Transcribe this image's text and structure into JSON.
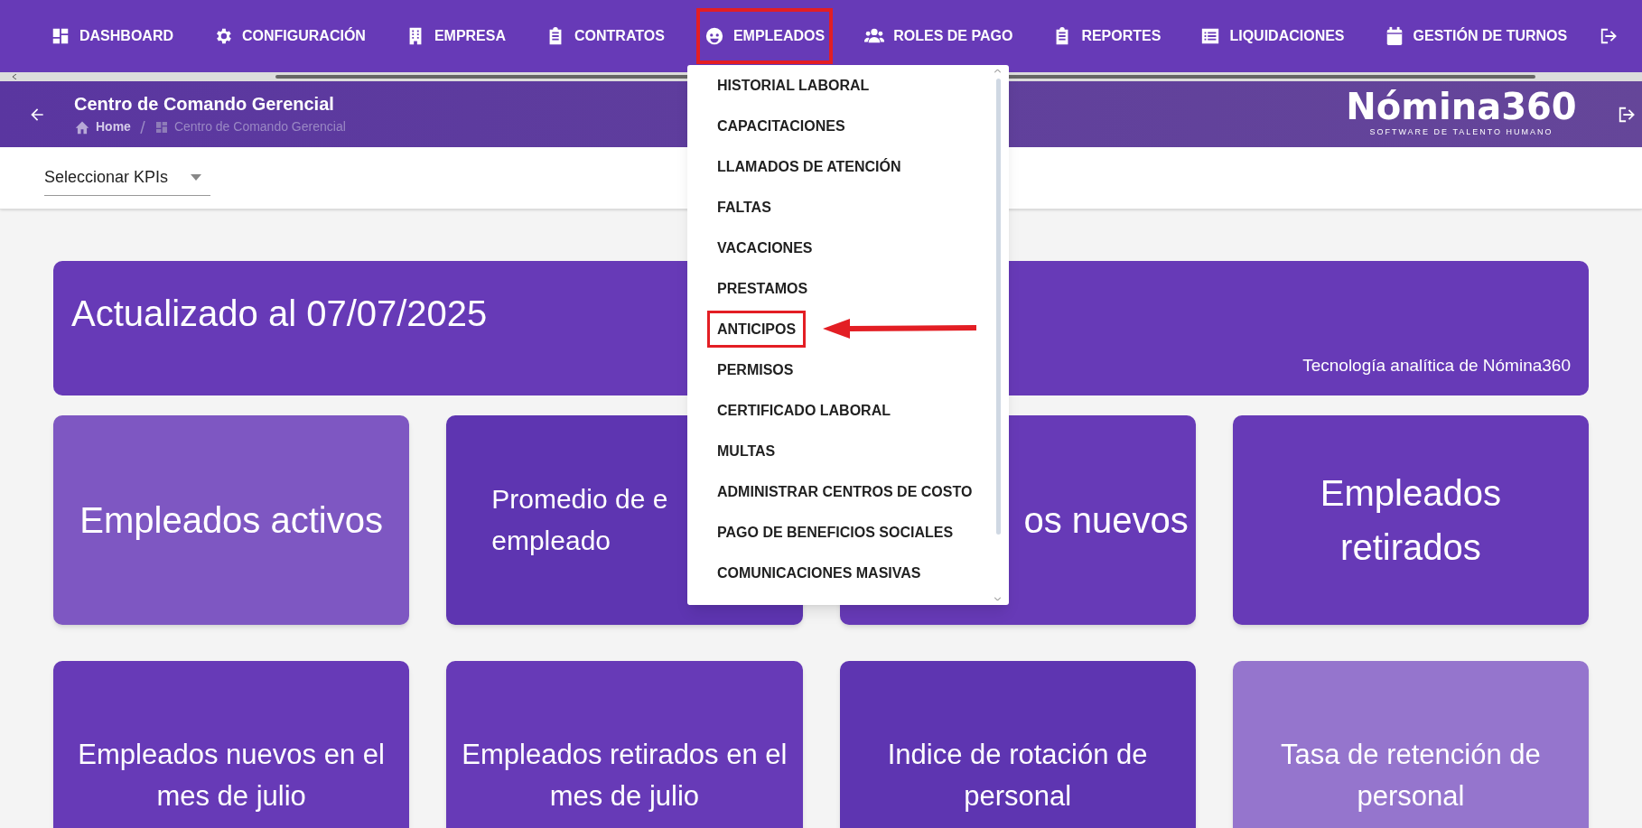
{
  "nav": {
    "items": [
      {
        "label": "DASHBOARD",
        "highlighted": false
      },
      {
        "label": "CONFIGURACIÓN",
        "highlighted": false
      },
      {
        "label": "EMPRESA",
        "highlighted": false
      },
      {
        "label": "CONTRATOS",
        "highlighted": false
      },
      {
        "label": "EMPLEADOS",
        "highlighted": true
      },
      {
        "label": "ROLES DE PAGO",
        "highlighted": false
      },
      {
        "label": "REPORTES",
        "highlighted": false
      },
      {
        "label": "LIQUIDACIONES",
        "highlighted": false
      },
      {
        "label": "GESTIÓN DE TURNOS",
        "highlighted": false
      }
    ]
  },
  "dropdown": {
    "items": [
      {
        "label": "HISTORIAL LABORAL",
        "highlighted": false
      },
      {
        "label": "CAPACITACIONES",
        "highlighted": false
      },
      {
        "label": "LLAMADOS DE ATENCIÓN",
        "highlighted": false
      },
      {
        "label": "FALTAS",
        "highlighted": false
      },
      {
        "label": "VACACIONES",
        "highlighted": false
      },
      {
        "label": "PRESTAMOS",
        "highlighted": false
      },
      {
        "label": "ANTICIPOS",
        "highlighted": true
      },
      {
        "label": "PERMISOS",
        "highlighted": false
      },
      {
        "label": "CERTIFICADO LABORAL",
        "highlighted": false
      },
      {
        "label": "MULTAS",
        "highlighted": false
      },
      {
        "label": "ADMINISTRAR CENTROS DE COSTO",
        "highlighted": false
      },
      {
        "label": "PAGO DE BENEFICIOS SOCIALES",
        "highlighted": false
      },
      {
        "label": "COMUNICACIONES MASIVAS",
        "highlighted": false
      }
    ]
  },
  "header": {
    "title": "Centro de Comando Gerencial",
    "breadcrumb": [
      "Home",
      "Centro de Comando Gerencial"
    ],
    "logo": "Nómina360",
    "logo_tagline": "SOFTWARE DE TALENTO HUMANO"
  },
  "kpi_select": {
    "value": "Seleccionar KPIs"
  },
  "banner": {
    "title": "Actualizado al 07/07/2025",
    "footer": "Tecnología analítica de Nómina360"
  },
  "cards": [
    {
      "lines": [
        "Empleados activos"
      ],
      "color": "#7e57c2"
    },
    {
      "lines": [
        "Promedio de e",
        "empleado"
      ],
      "color": "#5e35b1"
    },
    {
      "lines": [
        "os nuevos"
      ],
      "color": "#673ab7"
    },
    {
      "lines": [
        "Empleados",
        "retirados"
      ],
      "color": "#673ab7"
    },
    {
      "lines": [
        "Empleados nuevos en el",
        "mes de julio"
      ],
      "color": "#673ab7"
    },
    {
      "lines": [
        "Empleados retirados en el",
        "mes de julio"
      ],
      "color": "#673ab7"
    },
    {
      "lines": [
        "Indice de rotación de",
        "personal"
      ],
      "color": "#5e35b1"
    },
    {
      "lines": [
        "Tasa de retención de",
        "personal"
      ],
      "color": "#9575cd"
    }
  ]
}
